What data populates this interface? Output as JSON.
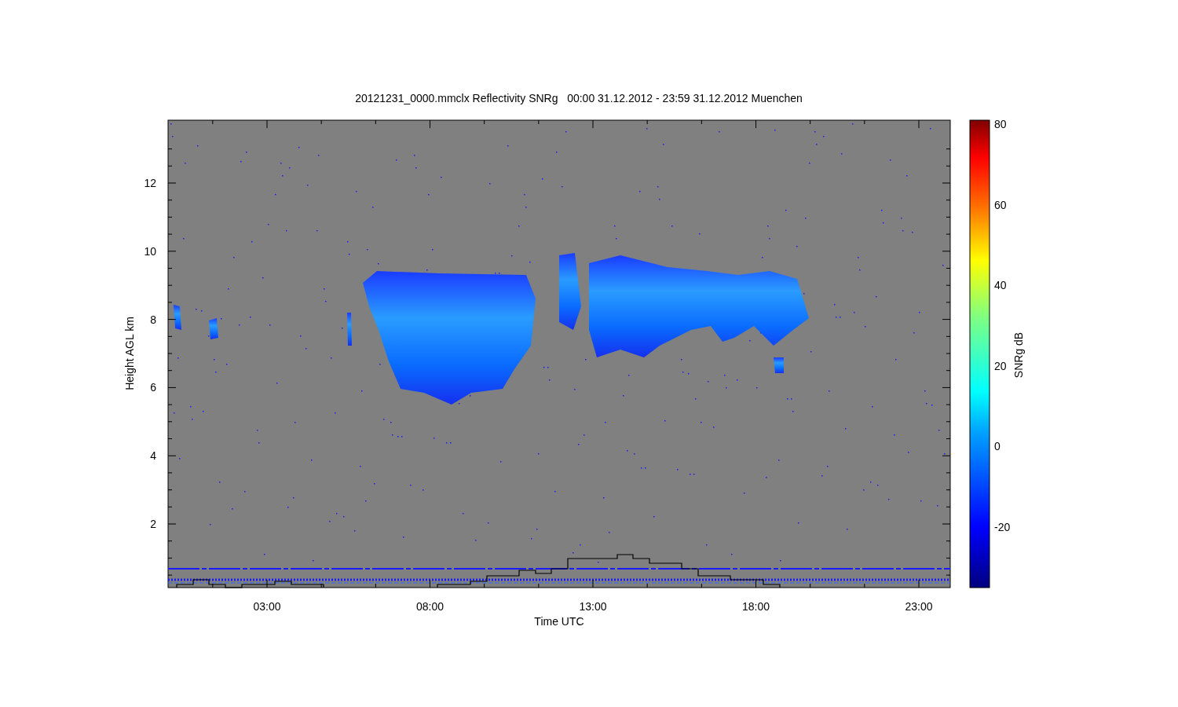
{
  "title": "20121231_0000.mmclx Reflectivity SNRg   00:00 31.12.2012 - 23:59 31.12.2012 Muenchen",
  "plot": {
    "xlabel": "Time UTC",
    "ylabel": "Height AGL km",
    "xtick_labels": [
      "03:00",
      "08:00",
      "13:00",
      "18:00",
      "23:00"
    ],
    "ytick_labels": [
      "12",
      "10",
      "8",
      "6",
      "4",
      "2"
    ]
  },
  "colorbar": {
    "label": "SNRg dB",
    "tick_labels": [
      "80",
      "60",
      "40",
      "20",
      "0",
      "-20"
    ]
  }
}
